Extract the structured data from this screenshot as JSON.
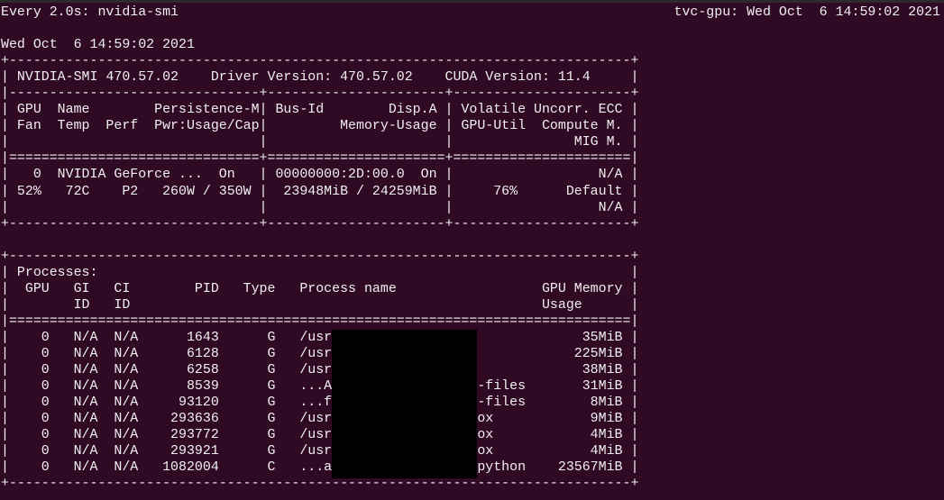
{
  "window": {
    "watch_header": "Every 2.0s: nvidia-smi",
    "host_time": "tvc-gpu: Wed Oct  6 14:59:02 2021"
  },
  "lines": [
    "",
    "Wed Oct  6 14:59:02 2021",
    "+-----------------------------------------------------------------------------+",
    "| NVIDIA-SMI 470.57.02    Driver Version: 470.57.02    CUDA Version: 11.4     |",
    "|-------------------------------+----------------------+----------------------+",
    "| GPU  Name        Persistence-M| Bus-Id        Disp.A | Volatile Uncorr. ECC |",
    "| Fan  Temp  Perf  Pwr:Usage/Cap|         Memory-Usage | GPU-Util  Compute M. |",
    "|                               |                      |               MIG M. |",
    "|===============================+======================+======================|",
    "|   0  NVIDIA GeForce ...  On   | 00000000:2D:00.0  On |                  N/A |",
    "| 52%   72C    P2   260W / 350W |  23948MiB / 24259MiB |     76%      Default |",
    "|                               |                      |                  N/A |",
    "+-------------------------------+----------------------+----------------------+",
    "",
    "+-----------------------------------------------------------------------------+",
    "| Processes:                                                                  |",
    "|  GPU   GI   CI        PID   Type   Process name                  GPU Memory |",
    "|        ID   ID                                                   Usage      |",
    "|=============================================================================|",
    "|    0   N/A  N/A      1643      G   /usr                               35MiB |",
    "|    0   N/A  N/A      6128      G   /usr                              225MiB |",
    "|    0   N/A  N/A      6258      G   /usr                               38MiB |",
    "|    0   N/A  N/A      8539      G   ...A                  -files       31MiB |",
    "|    0   N/A  N/A     93120      G   ...f                  -files        8MiB |",
    "|    0   N/A  N/A    293636      G   /usr                  ox            9MiB |",
    "|    0   N/A  N/A    293772      G   /usr                  ox            4MiB |",
    "|    0   N/A  N/A    293921      G   /usr                  ox            4MiB |",
    "|    0   N/A  N/A   1082004      C   ...a                  python    23567MiB |",
    "+-----------------------------------------------------------------------------+"
  ],
  "colors": {
    "background": "#300a24",
    "text": "#f0f0f0",
    "redaction": "#000000"
  }
}
